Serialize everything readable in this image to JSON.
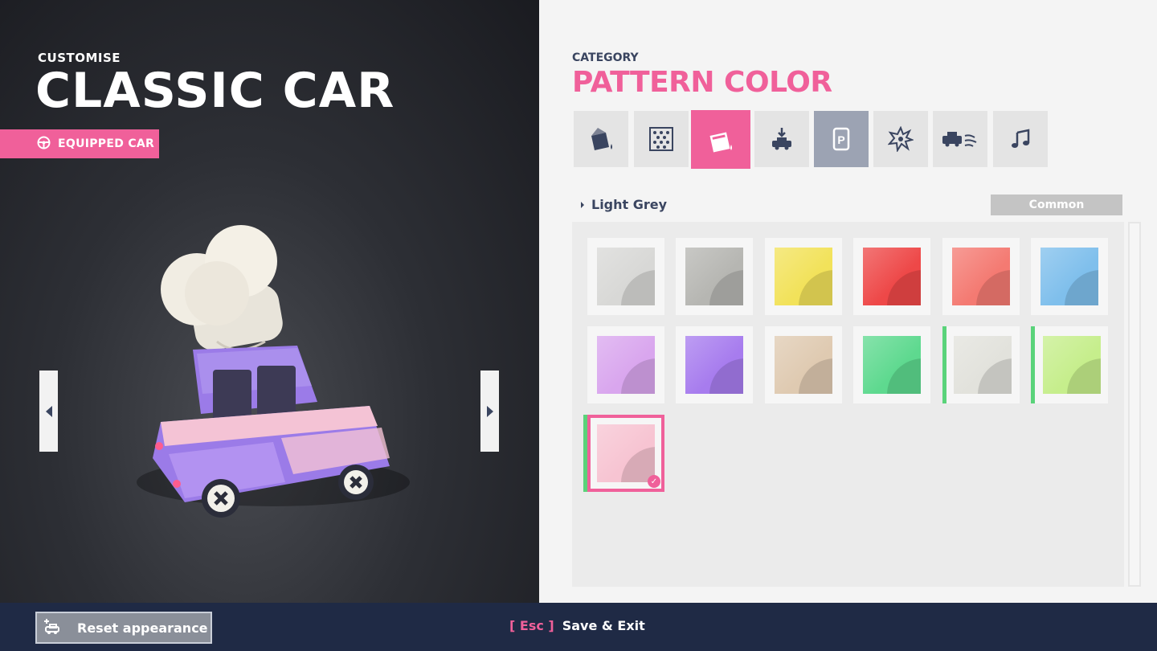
{
  "header": {
    "subtitle": "CUSTOMISE",
    "title": "CLASSIC CAR",
    "equipped_label": "EQUIPPED CAR"
  },
  "category": {
    "label": "CATEGORY",
    "title": "PATTERN COLOR",
    "tabs": [
      {
        "icon": "paint-bucket-icon",
        "state": "normal"
      },
      {
        "icon": "pattern-dots-icon",
        "state": "normal"
      },
      {
        "icon": "pattern-color-bucket-icon",
        "state": "active"
      },
      {
        "icon": "car-drop-icon",
        "state": "normal"
      },
      {
        "icon": "license-plate-icon",
        "state": "highlighted"
      },
      {
        "icon": "explosion-icon",
        "state": "normal"
      },
      {
        "icon": "car-trail-icon",
        "state": "normal"
      },
      {
        "icon": "music-note-icon",
        "state": "normal"
      }
    ]
  },
  "selection": {
    "name": "Light Grey",
    "rarity": "Common"
  },
  "swatches": [
    {
      "color": "#d8d8d6",
      "new": false,
      "selected": false
    },
    {
      "color": "#b6b6b2",
      "new": false,
      "selected": false
    },
    {
      "color": "#f2e25a",
      "new": false,
      "selected": false
    },
    {
      "color": "#ee4848",
      "new": false,
      "selected": false
    },
    {
      "color": "#f47a72",
      "new": false,
      "selected": false
    },
    {
      "color": "#7fbfec",
      "new": false,
      "selected": false
    },
    {
      "color": "#d9a6ee",
      "new": false,
      "selected": false
    },
    {
      "color": "#a77cee",
      "new": false,
      "selected": false
    },
    {
      "color": "#dfcab1",
      "new": false,
      "selected": false
    },
    {
      "color": "#5ed98f",
      "new": false,
      "selected": false
    },
    {
      "color": "#e2e2dc",
      "new": true,
      "selected": false
    },
    {
      "color": "#c6ee8c",
      "new": true,
      "selected": false
    },
    {
      "color": "#f7c4d2",
      "new": true,
      "selected": true
    }
  ],
  "footer": {
    "reset_label": "Reset appearance",
    "esc_key": "[ Esc ]",
    "esc_label": "Save & Exit"
  },
  "colors": {
    "accent": "#f0609a",
    "navy": "#1f2a45",
    "new_marker": "#5ad37a"
  }
}
